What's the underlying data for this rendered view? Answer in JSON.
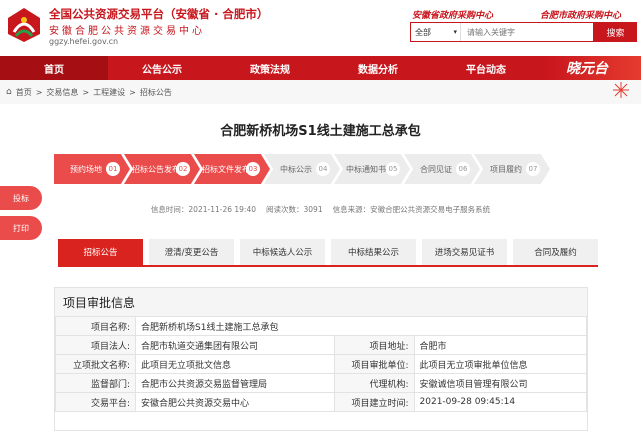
{
  "header": {
    "title": "全国公共资源交易平台（安徽省 · 合肥市）",
    "subtitle": "安徽合肥公共资源交易中心",
    "url": "ggzy.hefei.gov.cn",
    "slogan_left": "安徽省政府采购中心",
    "slogan_right": "合肥市政府采购中心",
    "search_select": "全部",
    "search_placeholder": "请输入关键字",
    "search_button": "搜索",
    "logo_icon": "emblem-icon"
  },
  "nav": {
    "items": [
      "首页",
      "公告公示",
      "政策法规",
      "数据分析",
      "平台动态"
    ],
    "banner": "晓元台"
  },
  "breadcrumb": [
    "首页",
    "交易信息",
    "工程建设",
    "招标公告"
  ],
  "main": {
    "title": "合肥新桥机场S1线土建施工总承包",
    "steps": [
      {
        "label": "预约场地",
        "num": "01",
        "done": true
      },
      {
        "label": "招标公告发布",
        "num": "02",
        "done": true
      },
      {
        "label": "招标文件发布",
        "num": "03",
        "done": true
      },
      {
        "label": "中标公示",
        "num": "04",
        "done": false
      },
      {
        "label": "中标通知书",
        "num": "05",
        "done": false
      },
      {
        "label": "合同见证",
        "num": "06",
        "done": false
      },
      {
        "label": "项目履约",
        "num": "07",
        "done": false
      }
    ],
    "meta": {
      "time_label": "信息时间：",
      "time_value": "2021-11-26 19:40",
      "views_label": "阅读次数：",
      "views_value": "3091",
      "source_label": "信息来源：",
      "source_value": "安徽合肥公共资源交易电子服务系统"
    },
    "side_buttons": [
      "投标",
      "打印"
    ],
    "tabs": [
      "招标公告",
      "澄清/变更公告",
      "中标候选人公示",
      "中标结果公示",
      "进场交易见证书",
      "合同及履约"
    ],
    "section_title": "项目审批信息",
    "rows": [
      [
        {
          "k": "项目名称:",
          "v": "合肥新桥机场S1线土建施工总承包"
        }
      ],
      [
        {
          "k": "项目法人:",
          "v": "合肥市轨道交通集团有限公司"
        },
        {
          "k": "项目地址:",
          "v": "合肥市"
        }
      ],
      [
        {
          "k": "立项批文名称:",
          "v": "此项目无立项批文信息"
        },
        {
          "k": "项目审批单位:",
          "v": "此项目无立项审批单位信息"
        }
      ],
      [
        {
          "k": "监督部门:",
          "v": "合肥市公共资源交易监督管理局"
        },
        {
          "k": "代理机构:",
          "v": "安徽诚信项目管理有限公司"
        }
      ],
      [
        {
          "k": "交易平台:",
          "v": "安徽合肥公共资源交易中心"
        },
        {
          "k": "项目建立时间:",
          "v": "2021-09-28 09:45:14"
        }
      ]
    ]
  }
}
